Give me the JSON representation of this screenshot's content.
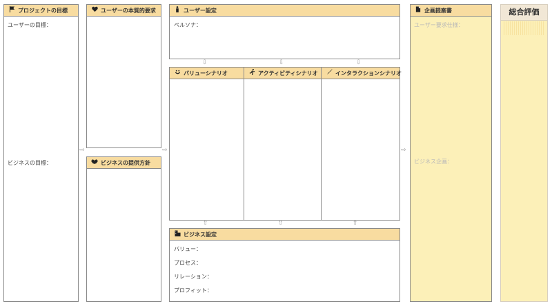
{
  "project_goal": {
    "title": "プロジェクトの目標",
    "user_goal_label": "ユーザーの目標：",
    "business_goal_label": "ビジネスの目標："
  },
  "essential_needs": {
    "title": "ユーザーの本質的要求"
  },
  "business_policy": {
    "title": "ビジネスの提供方針"
  },
  "user_settings": {
    "title": "ユーザー設定",
    "persona_label": "ペルソナ："
  },
  "value_scenario": {
    "title": "バリューシナリオ"
  },
  "activity_scenario": {
    "title": "アクティビティシナリオ"
  },
  "interaction_scenario": {
    "title": "インタラクションシナリオ"
  },
  "business_settings": {
    "title": "ビジネス設定",
    "value_label": "バリュー：",
    "process_label": "プロセス：",
    "relation_label": "リレーション：",
    "profit_label": "プロフィット："
  },
  "proposal": {
    "title": "企画提案書",
    "user_req_label": "ユーザー要求仕様：",
    "business_plan_label": "ビジネス企画："
  },
  "evaluation": {
    "title": "総合評価"
  },
  "colors": {
    "header": "#f8dca0",
    "proposal_fill": "#fcf0b8",
    "eval_header": "#f1e7d6",
    "border": "#8a8a8a"
  },
  "icons": {
    "project_goal": "flag-icon",
    "essential_needs": "heart-icon",
    "business_policy": "handshake-icon",
    "user_settings": "person-icon",
    "value_scenario": "smile-icon",
    "activity_scenario": "running-icon",
    "interaction_scenario": "pen-icon",
    "business_settings": "building-icon",
    "proposal": "document-icon"
  }
}
